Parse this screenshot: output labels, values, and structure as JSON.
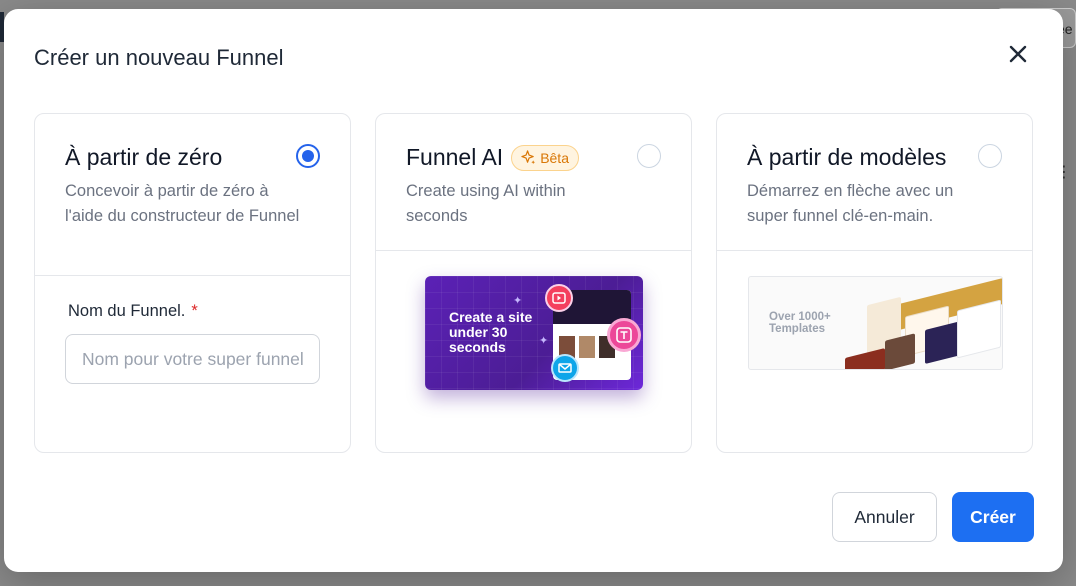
{
  "background": {
    "right_button_fragment": "ée"
  },
  "modal": {
    "title": "Créer un nouveau Funnel",
    "close_icon": "close-icon"
  },
  "cards": [
    {
      "title": "À partir de zéro",
      "description": "Concevoir à partir de zéro à l'aide du constructeur de Funnel",
      "selected": true,
      "field": {
        "label": "Nom du Funnel.",
        "required_mark": "*",
        "placeholder": "Nom pour votre super funnel",
        "value": ""
      }
    },
    {
      "title": "Funnel AI",
      "badge": "Bêta",
      "badge_icon": "sparkle-icon",
      "description": "Create using AI within seconds",
      "selected": false,
      "preview_text": "Create a site under 30 seconds"
    },
    {
      "title": "À partir de modèles",
      "description": "Démarrez en flèche avec un super funnel clé-en-main.",
      "selected": false,
      "preview_text": "Over 1000+ Templates"
    }
  ],
  "footer": {
    "cancel_label": "Annuler",
    "create_label": "Créer"
  },
  "colors": {
    "primary": "#1d6ff2",
    "badge_bg": "#fff4e0",
    "badge_text": "#d97706",
    "required": "#dc2626"
  }
}
